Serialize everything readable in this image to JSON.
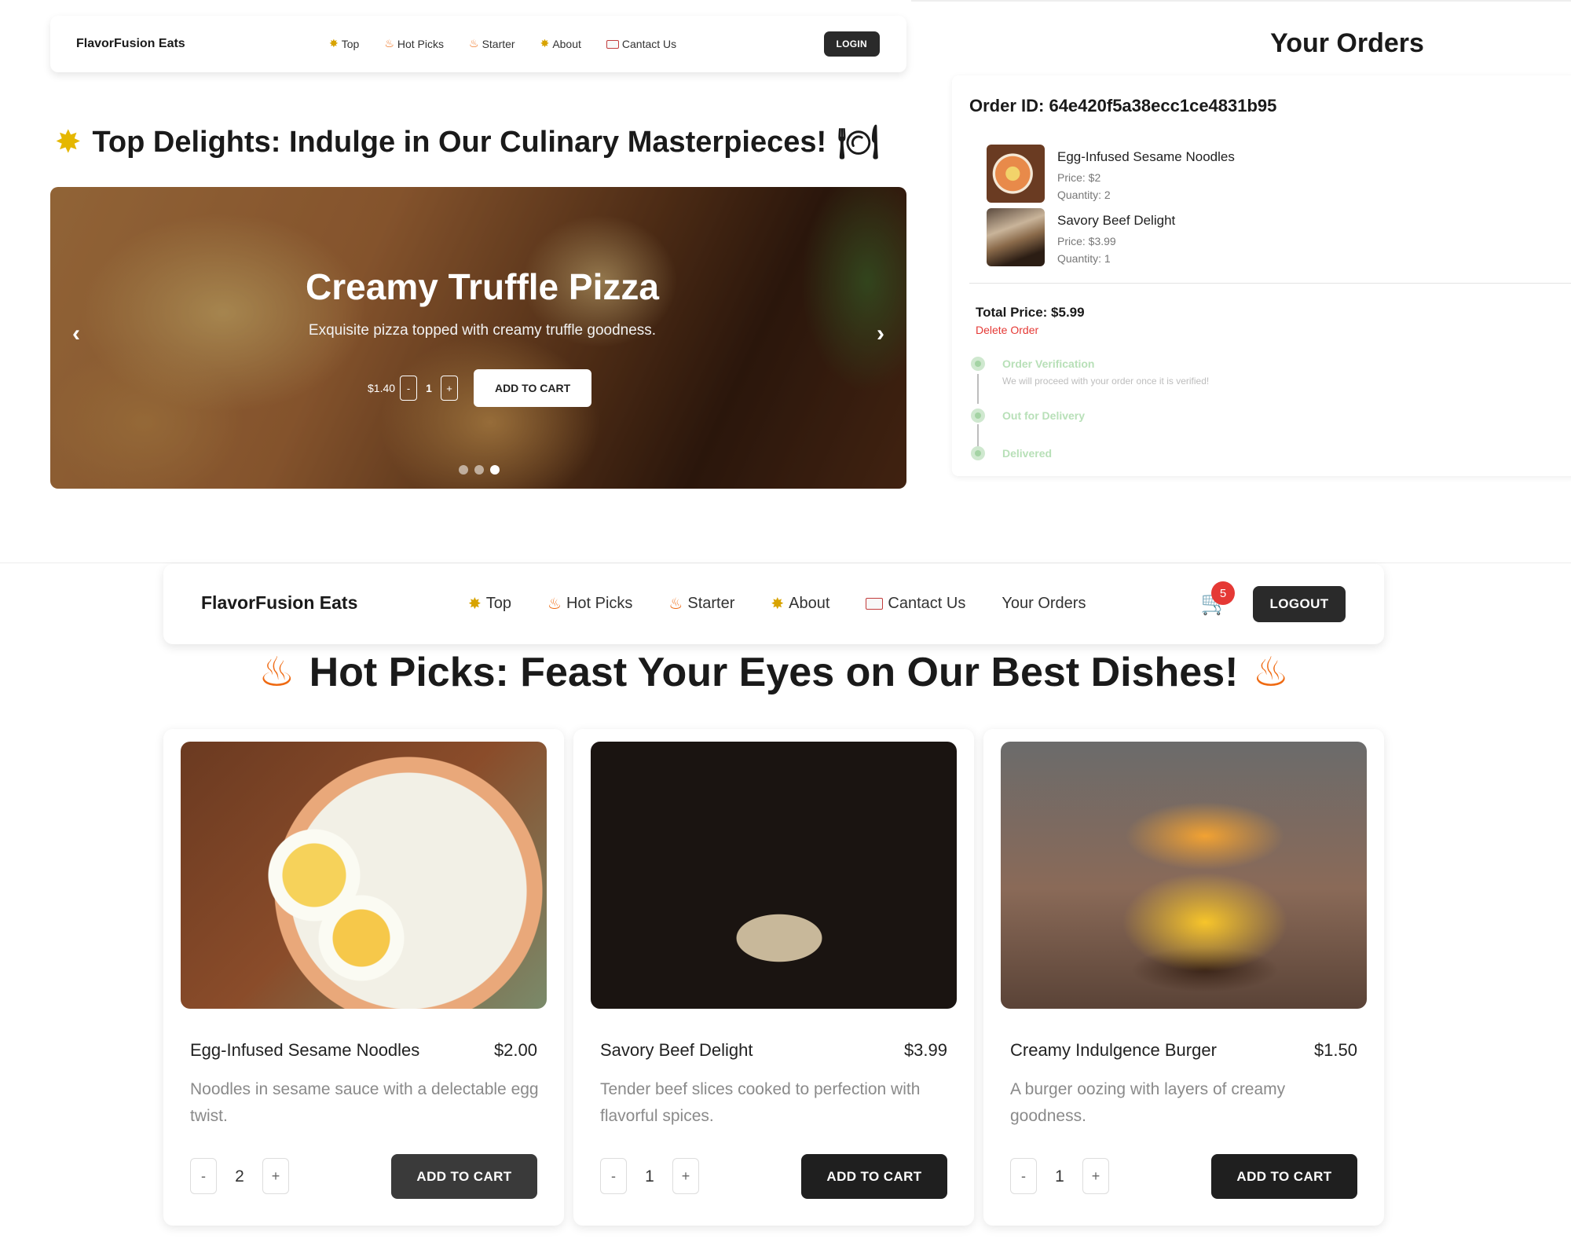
{
  "top_nav": {
    "brand": "FlavorFusion Eats",
    "links": [
      {
        "label": "Top",
        "icon": "star-icon"
      },
      {
        "label": "Hot Picks",
        "icon": "fire-icon"
      },
      {
        "label": "Starter",
        "icon": "fire-icon"
      },
      {
        "label": "About",
        "icon": "star-icon"
      },
      {
        "label": "Cantact Us",
        "icon": "mail-icon"
      }
    ],
    "login_label": "LOGIN"
  },
  "top_section": {
    "heading": "Top Delights: Indulge in Our Culinary Masterpieces!",
    "carousel": {
      "title": "Creamy Truffle Pizza",
      "description": "Exquisite pizza topped with creamy truffle goodness.",
      "price": "$1.40",
      "minus": "-",
      "quantity": "1",
      "plus": "+",
      "add_to_cart": "ADD TO CART",
      "prev": "‹",
      "next": "›",
      "dots": 3,
      "active_dot": 3
    }
  },
  "orders": {
    "title": "Your Orders",
    "order_id_label": "Order ID: 64e420f5a38ecc1ce4831b95",
    "items": [
      {
        "name": "Egg-Infused Sesame Noodles",
        "price": "Price: $2",
        "quantity": "Quantity: 2"
      },
      {
        "name": "Savory Beef Delight",
        "price": "Price: $3.99",
        "quantity": "Quantity: 1"
      }
    ],
    "total": "Total Price: $5.99",
    "delete": "Delete Order",
    "status_steps": [
      {
        "label": "Order Verification",
        "sub": "We will proceed with your order once it is verified!"
      },
      {
        "label": "Out for Delivery",
        "sub": ""
      },
      {
        "label": "Delivered",
        "sub": ""
      }
    ]
  },
  "bottom_nav": {
    "brand": "FlavorFusion Eats",
    "links": [
      {
        "label": "Top",
        "icon": "star-icon"
      },
      {
        "label": "Hot Picks",
        "icon": "fire-icon"
      },
      {
        "label": "Starter",
        "icon": "fire-icon"
      },
      {
        "label": "About",
        "icon": "star-icon"
      },
      {
        "label": "Cantact Us",
        "icon": "mail-icon"
      },
      {
        "label": "Your Orders",
        "icon": ""
      }
    ],
    "cart_count": "5",
    "logout_label": "LOGOUT"
  },
  "hot_picks": {
    "heading": "Hot Picks: Feast Your Eyes on Our Best Dishes!",
    "cards": [
      {
        "name": "Egg-Infused Sesame Noodles",
        "price": "$2.00",
        "description": "Noodles in sesame sauce with a delectable egg twist.",
        "minus": "-",
        "quantity": "2",
        "plus": "+",
        "add_to_cart": "ADD TO CART"
      },
      {
        "name": "Savory Beef Delight",
        "price": "$3.99",
        "description": "Tender beef slices cooked to perfection with flavorful spices.",
        "minus": "-",
        "quantity": "1",
        "plus": "+",
        "add_to_cart": "ADD TO CART"
      },
      {
        "name": "Creamy Indulgence Burger",
        "price": "$1.50",
        "description": "A burger oozing with layers of creamy goodness.",
        "minus": "-",
        "quantity": "1",
        "plus": "+",
        "add_to_cart": "ADD TO CART"
      }
    ]
  },
  "colors": {
    "dark_button": "#2a2a2a",
    "danger": "#e53935",
    "step_green": "#b8e0b8"
  }
}
